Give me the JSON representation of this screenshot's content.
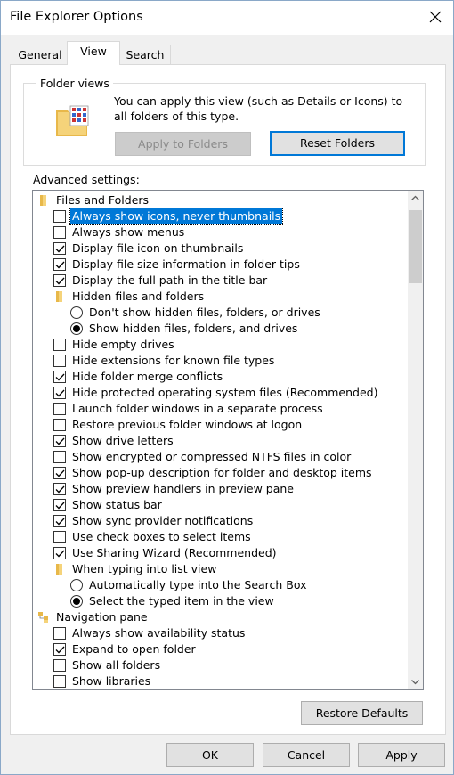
{
  "window": {
    "title": "File Explorer Options"
  },
  "tabs": [
    {
      "label": "General"
    },
    {
      "label": "View"
    },
    {
      "label": "Search"
    }
  ],
  "folder_views": {
    "group_label": "Folder views",
    "description": "You can apply this view (such as Details or Icons) to all folders of this type.",
    "apply_button": "Apply to Folders",
    "reset_button": "Reset Folders"
  },
  "advanced": {
    "label": "Advanced settings:",
    "items": [
      {
        "kind": "folder",
        "label": "Files and Folders",
        "indent": 0
      },
      {
        "kind": "check",
        "label": "Always show icons, never thumbnails",
        "checked": false,
        "selected": true,
        "indent": 1
      },
      {
        "kind": "check",
        "label": "Always show menus",
        "checked": false,
        "indent": 1
      },
      {
        "kind": "check",
        "label": "Display file icon on thumbnails",
        "checked": true,
        "indent": 1
      },
      {
        "kind": "check",
        "label": "Display file size information in folder tips",
        "checked": true,
        "indent": 1
      },
      {
        "kind": "check",
        "label": "Display the full path in the title bar",
        "checked": true,
        "indent": 1
      },
      {
        "kind": "folder",
        "label": "Hidden files and folders",
        "indent": 1
      },
      {
        "kind": "radio",
        "label": "Don't show hidden files, folders, or drives",
        "checked": false,
        "indent": 2
      },
      {
        "kind": "radio",
        "label": "Show hidden files, folders, and drives",
        "checked": true,
        "indent": 2
      },
      {
        "kind": "check",
        "label": "Hide empty drives",
        "checked": false,
        "indent": 1
      },
      {
        "kind": "check",
        "label": "Hide extensions for known file types",
        "checked": false,
        "indent": 1
      },
      {
        "kind": "check",
        "label": "Hide folder merge conflicts",
        "checked": true,
        "indent": 1
      },
      {
        "kind": "check",
        "label": "Hide protected operating system files (Recommended)",
        "checked": true,
        "indent": 1
      },
      {
        "kind": "check",
        "label": "Launch folder windows in a separate process",
        "checked": false,
        "indent": 1
      },
      {
        "kind": "check",
        "label": "Restore previous folder windows at logon",
        "checked": false,
        "indent": 1
      },
      {
        "kind": "check",
        "label": "Show drive letters",
        "checked": true,
        "indent": 1
      },
      {
        "kind": "check",
        "label": "Show encrypted or compressed NTFS files in color",
        "checked": false,
        "indent": 1
      },
      {
        "kind": "check",
        "label": "Show pop-up description for folder and desktop items",
        "checked": true,
        "indent": 1
      },
      {
        "kind": "check",
        "label": "Show preview handlers in preview pane",
        "checked": true,
        "indent": 1
      },
      {
        "kind": "check",
        "label": "Show status bar",
        "checked": true,
        "indent": 1
      },
      {
        "kind": "check",
        "label": "Show sync provider notifications",
        "checked": true,
        "indent": 1
      },
      {
        "kind": "check",
        "label": "Use check boxes to select items",
        "checked": false,
        "indent": 1
      },
      {
        "kind": "check",
        "label": "Use Sharing Wizard (Recommended)",
        "checked": true,
        "indent": 1
      },
      {
        "kind": "folder",
        "label": "When typing into list view",
        "indent": 1
      },
      {
        "kind": "radio",
        "label": "Automatically type into the Search Box",
        "checked": false,
        "indent": 2
      },
      {
        "kind": "radio",
        "label": "Select the typed item in the view",
        "checked": true,
        "indent": 2
      },
      {
        "kind": "navfolder",
        "label": "Navigation pane",
        "indent": 0
      },
      {
        "kind": "check",
        "label": "Always show availability status",
        "checked": false,
        "indent": 1
      },
      {
        "kind": "check",
        "label": "Expand to open folder",
        "checked": true,
        "indent": 1
      },
      {
        "kind": "check",
        "label": "Show all folders",
        "checked": false,
        "indent": 1
      },
      {
        "kind": "check",
        "label": "Show libraries",
        "checked": false,
        "indent": 1
      }
    ],
    "restore_button": "Restore Defaults"
  },
  "footer": {
    "ok": "OK",
    "cancel": "Cancel",
    "apply": "Apply"
  },
  "colors": {
    "accent": "#0078d7",
    "folder": "#e8b84a"
  }
}
